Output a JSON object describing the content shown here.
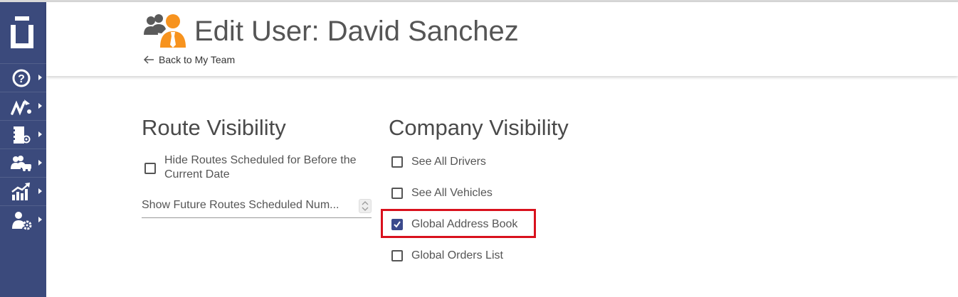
{
  "sidebar": {
    "logo": "app-logo",
    "items": [
      {
        "icon": "help-icon"
      },
      {
        "icon": "routes-icon"
      },
      {
        "icon": "address-book-icon"
      },
      {
        "icon": "team-vehicle-icon"
      },
      {
        "icon": "analytics-icon"
      },
      {
        "icon": "user-settings-icon"
      }
    ]
  },
  "header": {
    "title": "Edit User: David Sanchez",
    "back_label": "Back to My Team",
    "icon": "team-users-icon"
  },
  "route_visibility": {
    "heading": "Route Visibility",
    "hide_routes": {
      "label_line1": "Hide Routes Scheduled for Before the",
      "label_line2": "Current Date",
      "checked": false
    },
    "future_routes_select": {
      "value": "Show Future Routes Scheduled Num..."
    }
  },
  "company_visibility": {
    "heading": "Company Visibility",
    "options": [
      {
        "label": "See All Drivers",
        "checked": false
      },
      {
        "label": "See All Vehicles",
        "checked": false
      },
      {
        "label": "Global Address Book",
        "checked": true
      },
      {
        "label": "Global Orders List",
        "checked": false
      }
    ]
  },
  "colors": {
    "sidebar": "#3b4a7c",
    "accent": "#3b4a8c",
    "highlight": "#d9111d",
    "orange": "#f7931e"
  }
}
